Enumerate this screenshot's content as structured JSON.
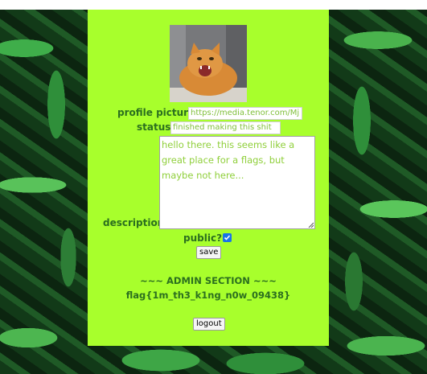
{
  "profile": {
    "picture_label": "profile picture:",
    "picture_value": "https://media.tenor.com/Mj",
    "status_label": "status:",
    "status_value": "finished making this shit",
    "description_label": "description:",
    "description_value": "hello there. this seems like a great place for a flags, but maybe not here...",
    "public_label": "public?:",
    "public_checked": true,
    "save_label": "save"
  },
  "admin": {
    "heading": "~~~ ADMIN SECTION ~~~",
    "flag": "flag{1m_th3_k1ng_n0w_09438}"
  },
  "logout_label": "logout",
  "colors": {
    "panel": "#a8ff2c",
    "text": "#2b6f1f",
    "checkbox": "#1a73e8"
  }
}
